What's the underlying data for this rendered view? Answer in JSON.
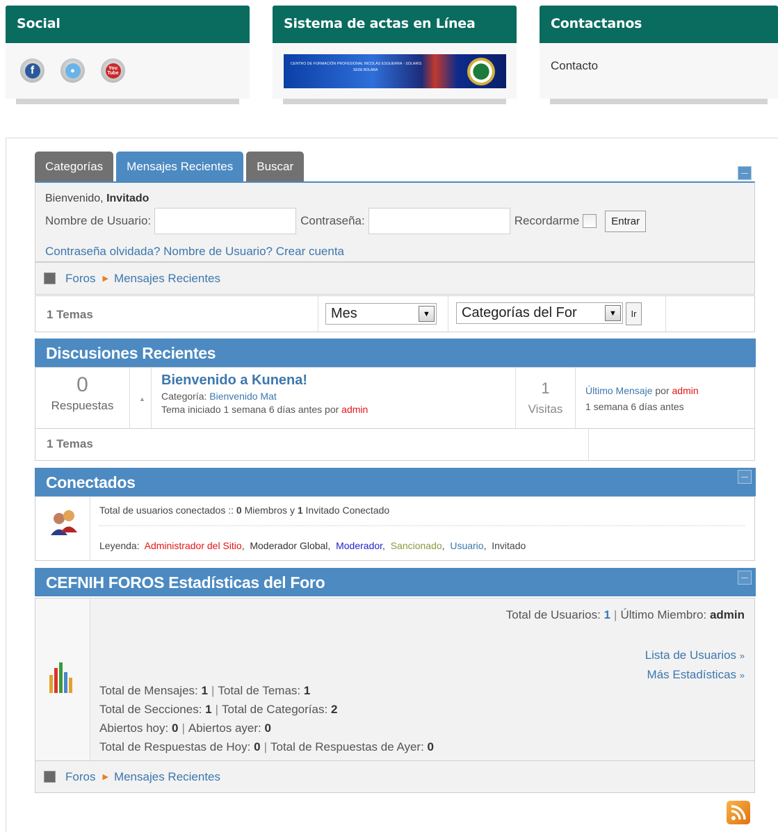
{
  "widgets": {
    "social": {
      "title": "Social",
      "icons": [
        "facebook-icon",
        "twitter-icon",
        "youtube-icon"
      ],
      "youtube_text": "You Tube"
    },
    "actas": {
      "title": "Sistema de actas en Línea",
      "banner_text": "CENTRO DE FORMACIÓN PROFESIONAL NICOLÁS ESGUERRA - SOLARIS",
      "banner_sub": "SEDE BOLARA"
    },
    "contact": {
      "title": "Contactanos",
      "link": "Contacto"
    }
  },
  "tabs": [
    "Categorías",
    "Mensajes Recientes",
    "Buscar"
  ],
  "login": {
    "welcome_prefix": "Bienvenido,",
    "welcome_user": "Invitado",
    "username_label": "Nombre de Usuario:",
    "password_label": "Contraseña:",
    "remember_label": "Recordarme",
    "submit": "Entrar",
    "links": [
      "Contraseña olvidada?",
      "Nombre de Usuario?",
      "Crear cuenta"
    ]
  },
  "breadcrumb": [
    "Foros",
    "Mensajes Recientes"
  ],
  "filter": {
    "count": "1 Temas",
    "period": "Mes",
    "category": "Categorías del For",
    "go": "Ir"
  },
  "recent": {
    "title": "Discusiones Recientes",
    "topic": {
      "replies": "0",
      "replies_label": "Respuestas",
      "title": "Bienvenido a Kunena!",
      "category_prefix": "Categoría:",
      "category": "Bienvenido Mat",
      "started": "Tema iniciado 1 semana 6 días antes por",
      "author": "admin",
      "views": "1",
      "views_label": "Visitas",
      "last_label": "Último Mensaje",
      "last_by": "por",
      "last_user": "admin",
      "last_time": "1 semana 6 días antes"
    },
    "footer_count": "1 Temas"
  },
  "online": {
    "title": "Conectados",
    "line1_prefix": "Total de usuarios conectados ::",
    "members": "0",
    "members_label": "Miembros y",
    "guests": "1",
    "guests_label": "Invitado Conectado",
    "legend_label": "Leyenda:",
    "legend": [
      {
        "label": "Administrador del Sitio",
        "color": "#e41414"
      },
      {
        "label": "Moderador Global",
        "color": "#333333"
      },
      {
        "label": "Moderador",
        "color": "#2222cc"
      },
      {
        "label": "Sancionado",
        "color": "#8a9a3c"
      },
      {
        "label": "Usuario",
        "color": "#3d77ad"
      },
      {
        "label": "Invitado",
        "color": "#444444"
      }
    ]
  },
  "stats": {
    "title": "CEFNIH FOROS Estadísticas del Foro",
    "total_users_label": "Total de Usuarios:",
    "total_users": "1",
    "last_member_label": "Último Miembro:",
    "last_member": "admin",
    "links": [
      "Lista de Usuarios",
      "Más Estadísticas"
    ],
    "lines": [
      [
        [
          "Total de Mensajes:",
          "1"
        ],
        [
          "Total de Temas:",
          "1"
        ]
      ],
      [
        [
          "Total de Secciones:",
          "1"
        ],
        [
          "Total de Categorías:",
          "2"
        ]
      ],
      [
        [
          "Abiertos hoy:",
          "0"
        ],
        [
          "Abiertos ayer:",
          "0"
        ]
      ],
      [
        [
          "Total de Respuestas de Hoy:",
          "0"
        ],
        [
          "Total de Respuestas de Ayer:",
          "0"
        ]
      ]
    ]
  },
  "colors": {
    "teal": "#0a6b5f",
    "blue": "#4c8ac1",
    "link": "#3d77ad",
    "red": "#e41414",
    "rss": "#f28c1e"
  }
}
